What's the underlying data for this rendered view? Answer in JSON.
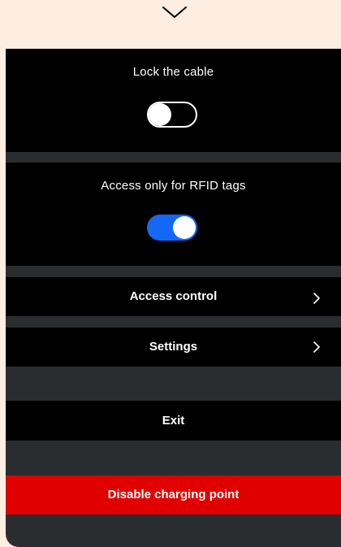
{
  "header": {
    "collapse_icon": "chevron-down-icon"
  },
  "toggles": {
    "lock_cable": {
      "label": "Lock the cable",
      "state": "off"
    },
    "rfid_only": {
      "label": "Access only for RFID tags",
      "state": "on"
    }
  },
  "menu": {
    "access_control": {
      "label": "Access control",
      "icon": "chevron-right-icon"
    },
    "settings": {
      "label": "Settings",
      "icon": "chevron-right-icon"
    }
  },
  "actions": {
    "exit_label": "Exit",
    "disable_label": "Disable charging point"
  },
  "colors": {
    "background": "#fdeee1",
    "panel": "#2a2d30",
    "block": "#000000",
    "toggle_on": "#1468f5",
    "danger": "#e00000",
    "text": "#ffffff"
  }
}
